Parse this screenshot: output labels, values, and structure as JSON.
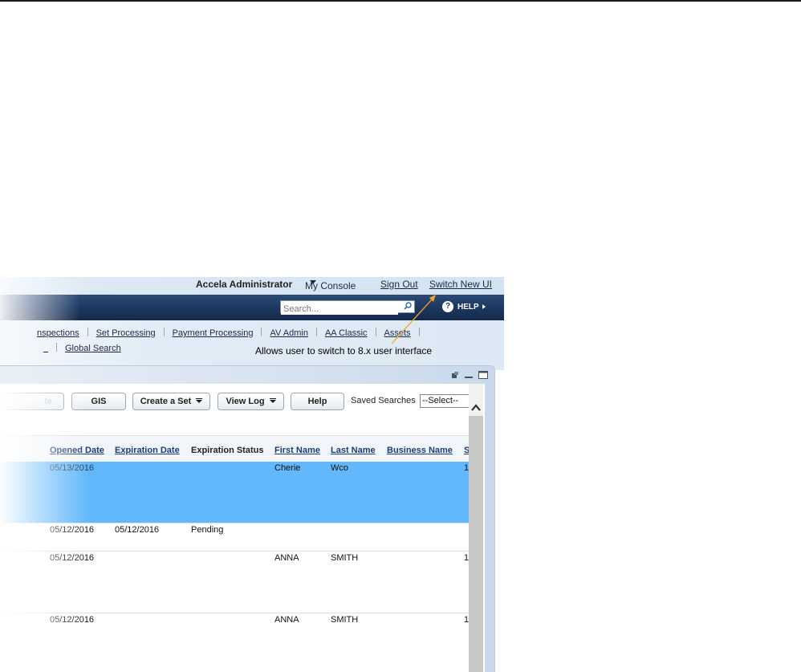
{
  "header": {
    "user": "Accela Administrator",
    "my_console": "My Console",
    "sign_out": "Sign Out",
    "switch_ui": "Switch New UI"
  },
  "search": {
    "placeholder": "Search..."
  },
  "help": {
    "label": "HELP"
  },
  "nav": {
    "row1": [
      "nspections",
      "Set Processing",
      "Payment Processing",
      "AV Admin",
      "AA Classic",
      "Assets"
    ],
    "row2": [
      "Global Search"
    ]
  },
  "annotation": {
    "text": "Allows user to switch to 8.x user interface",
    "color": "#f5a623"
  },
  "toolbar": {
    "partial_button": "te",
    "gis": "GIS",
    "create_set": "Create a Set",
    "view_log": "View Log",
    "help": "Help",
    "saved_searches": "Saved Searches",
    "select_value": "--Select--"
  },
  "grid": {
    "columns": [
      "Opened Date",
      "Expiration Date",
      "Expiration Status",
      "First Name",
      "Last Name",
      "Business Name",
      "S"
    ],
    "rows": [
      {
        "opened": "05/13/2016",
        "expiration": "",
        "status": "",
        "first": "Cherie",
        "last": "Wco",
        "business": "",
        "s": "1",
        "selected": true
      },
      {
        "opened": "05/12/2016",
        "expiration": "05/12/2016",
        "status": "Pending",
        "first": "",
        "last": "",
        "business": "",
        "s": "",
        "selected": false
      },
      {
        "opened": "05/12/2016",
        "expiration": "",
        "status": "",
        "first": "ANNA",
        "last": "SMITH",
        "business": "",
        "s": "1",
        "selected": false
      },
      {
        "opened": "05/12/2016",
        "expiration": "",
        "status": "",
        "first": "ANNA",
        "last": "SMITH",
        "business": "",
        "s": "1",
        "selected": false
      }
    ]
  },
  "colors": {
    "selected_row": "#62b8fb",
    "nav_bar": "#1c365f",
    "link": "#1b3c7a"
  }
}
